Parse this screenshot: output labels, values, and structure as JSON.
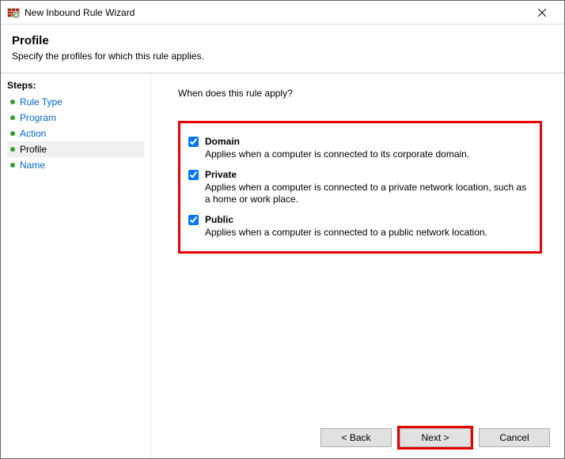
{
  "window": {
    "title": "New Inbound Rule Wizard"
  },
  "header": {
    "heading": "Profile",
    "subheading": "Specify the profiles for which this rule applies."
  },
  "sidebar": {
    "label": "Steps:",
    "items": [
      {
        "label": "Rule Type",
        "current": false
      },
      {
        "label": "Program",
        "current": false
      },
      {
        "label": "Action",
        "current": false
      },
      {
        "label": "Profile",
        "current": true
      },
      {
        "label": "Name",
        "current": false
      }
    ]
  },
  "main": {
    "question": "When does this rule apply?",
    "options": [
      {
        "label": "Domain",
        "checked": true,
        "desc": "Applies when a computer is connected to its corporate domain."
      },
      {
        "label": "Private",
        "checked": true,
        "desc": "Applies when a computer is connected to a private network location, such as a home or work place."
      },
      {
        "label": "Public",
        "checked": true,
        "desc": "Applies when a computer is connected to a public network location."
      }
    ]
  },
  "buttons": {
    "back": "< Back",
    "next": "Next >",
    "cancel": "Cancel"
  }
}
